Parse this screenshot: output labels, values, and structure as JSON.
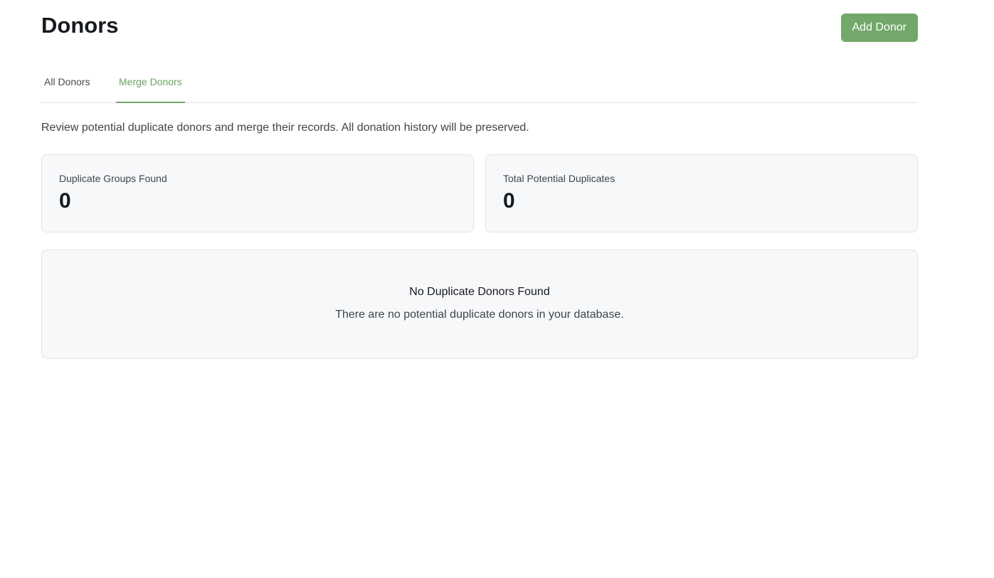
{
  "header": {
    "title": "Donors",
    "add_button_label": "Add Donor"
  },
  "tabs": [
    {
      "label": "All Donors",
      "active": false
    },
    {
      "label": "Merge Donors",
      "active": true
    }
  ],
  "merge": {
    "description": "Review potential duplicate donors and merge their records. All donation history will be preserved.",
    "stats": [
      {
        "label": "Duplicate Groups Found",
        "value": "0"
      },
      {
        "label": "Total Potential Duplicates",
        "value": "0"
      }
    ],
    "empty_state": {
      "title": "No Duplicate Donors Found",
      "text": "There are no potential duplicate donors in your database."
    }
  },
  "colors": {
    "accent": "#72a86a",
    "card_background": "#f7f8fa",
    "border": "#e1e3e6"
  }
}
